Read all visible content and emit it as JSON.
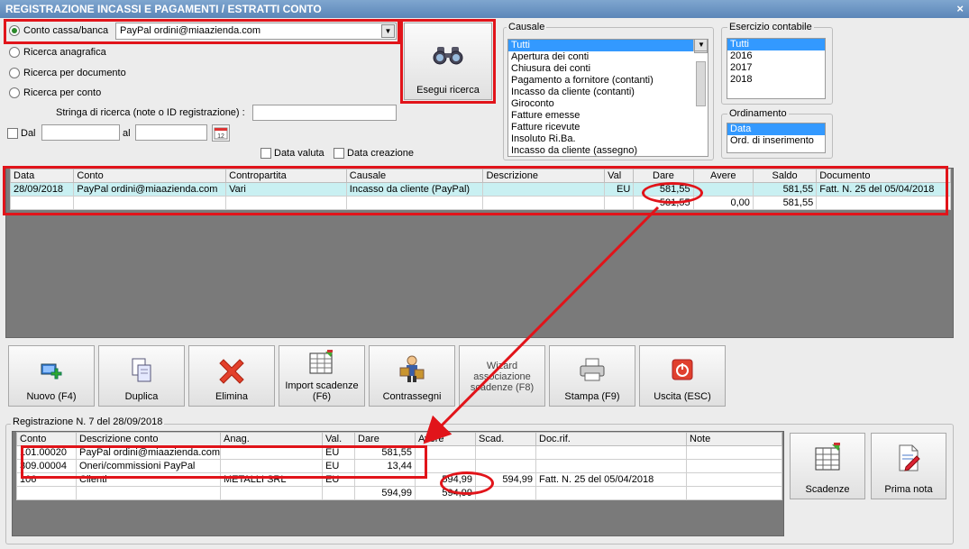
{
  "window": {
    "title": "REGISTRAZIONE INCASSI E PAGAMENTI / ESTRATTI CONTO",
    "close_glyph": "×"
  },
  "search": {
    "options": [
      "Conto cassa/banca",
      "Ricerca anagrafica",
      "Ricerca per documento",
      "Ricerca per conto"
    ],
    "selected_index": 0,
    "account_value": "PayPal ordini@miaazienda.com",
    "search_string_label": "Stringa di ricerca (note o ID registrazione) :",
    "search_string_value": "",
    "dal_label": "Dal",
    "al_label": "al",
    "date_from": "",
    "date_to": "",
    "data_valuta_label": "Data valuta",
    "data_creazione_label": "Data creazione",
    "search_button": "Esegui ricerca"
  },
  "causale": {
    "title": "Causale",
    "items": [
      "Tutti",
      "Apertura dei conti",
      "Chiusura dei conti",
      "Pagamento a fornitore (contanti)",
      "Incasso da cliente (contanti)",
      "Giroconto",
      "Fatture emesse",
      "Fatture ricevute",
      "Insoluto Ri.Ba.",
      "Incasso da cliente (assegno)"
    ],
    "selected_index": 0
  },
  "esercizio": {
    "title": "Esercizio contabile",
    "items": [
      "Tutti",
      "2016",
      "2017",
      "2018"
    ],
    "selected_index": 0
  },
  "ordinamento": {
    "title": "Ordinamento",
    "items": [
      "Data",
      "Ord. di inserimento"
    ],
    "selected_index": 0
  },
  "results": {
    "columns": [
      "Data",
      "Conto",
      "Contropartita",
      "Causale",
      "Descrizione",
      "Val",
      "Dare",
      "Avere",
      "Saldo",
      "Documento"
    ],
    "rows": [
      [
        "28/09/2018",
        "PayPal ordini@miaazienda.com",
        "Vari",
        "Incasso da cliente (PayPal)",
        "",
        "EU",
        "581,55",
        "",
        "581,55",
        "Fatt. N. 25 del 05/04/2018"
      ]
    ],
    "totals": [
      "",
      "",
      "",
      "",
      "",
      "",
      "581,55",
      "0,00",
      "581,55",
      ""
    ]
  },
  "toolbar": [
    {
      "label": "Nuovo (F4)",
      "icon": "new-icon"
    },
    {
      "label": "Duplica",
      "icon": "duplicate-icon"
    },
    {
      "label": "Elimina",
      "icon": "delete-icon"
    },
    {
      "label": "Import scadenze (F6)",
      "icon": "import-icon"
    },
    {
      "label": "Contrassegni",
      "icon": "courier-icon"
    },
    {
      "label": "Wizard associazione scadenze (F8)",
      "icon": ""
    },
    {
      "label": "Stampa (F9)",
      "icon": "printer-icon"
    },
    {
      "label": "Uscita (ESC)",
      "icon": "exit-icon"
    }
  ],
  "registration": {
    "title": "Registrazione N. 7 del 28/09/2018",
    "columns": [
      "Conto",
      "Descrizione conto",
      "Anag.",
      "Val.",
      "Dare",
      "Avere",
      "Scad.",
      "Doc.rif.",
      "Note"
    ],
    "rows": [
      [
        "101.00020",
        "PayPal ordini@miaazienda.com",
        "",
        "EU",
        "581,55",
        "",
        "",
        "",
        ""
      ],
      [
        "309.00004",
        "Oneri/commissioni PayPal",
        "",
        "EU",
        "13,44",
        "",
        "",
        "",
        ""
      ],
      [
        "106",
        "Clienti",
        "METALLI SRL",
        "EU",
        "",
        "594,99",
        "594,99",
        "Fatt. N. 25 del 05/04/2018",
        ""
      ]
    ],
    "totals": [
      "",
      "",
      "",
      "",
      "594,99",
      "594,99",
      "",
      "",
      ""
    ],
    "side_buttons": [
      {
        "label": "Scadenze",
        "icon": "calculator-icon"
      },
      {
        "label": "Prima nota",
        "icon": "edit-document-icon"
      }
    ]
  },
  "colors": {
    "highlight": "#e1141a",
    "selection": "#3399ff",
    "row_highlight": "#c9f0f2"
  }
}
